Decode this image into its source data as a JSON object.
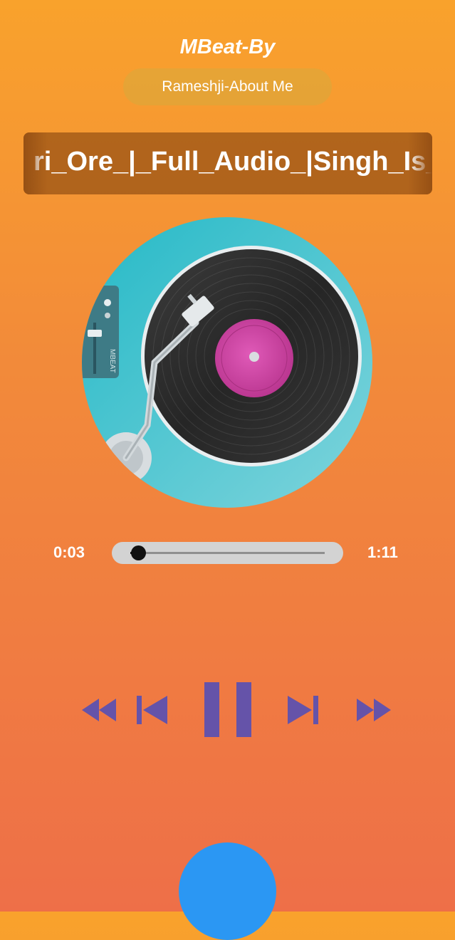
{
  "header": {
    "app_title": "MBeat-By",
    "about_label": "Rameshji-About Me"
  },
  "now_playing": {
    "song_title": "ri_Ore_|_Full_Audio_|Singh_Is_"
  },
  "album_art": {
    "mixer_label": "MBEAT"
  },
  "player": {
    "current_time": "0:03",
    "total_time": "1:11",
    "progress": 0.042
  },
  "controls": {
    "rewind_icon": "rewind-icon",
    "previous_icon": "skip-previous-icon",
    "pause_icon": "pause-icon",
    "next_icon": "skip-next-icon",
    "fast_forward_icon": "fast-forward-icon"
  },
  "colors": {
    "background_top": "#f9a22c",
    "background_bottom": "#ee6f48",
    "control_color": "#6553a9",
    "fab_color": "#2b97f3"
  }
}
